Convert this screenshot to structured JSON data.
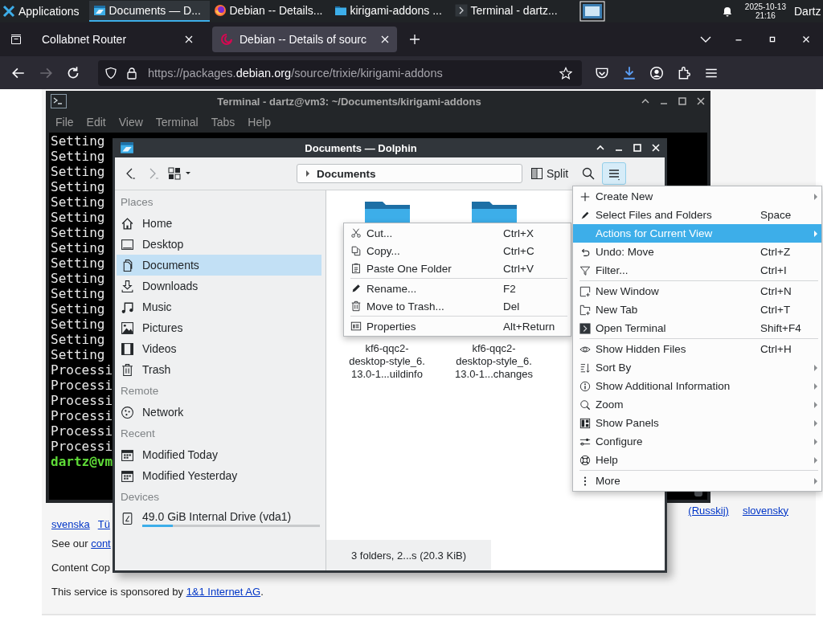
{
  "taskbar": {
    "launcher": "Applications",
    "tasks": [
      {
        "label": "Documents — D...",
        "kind": "dolphin",
        "selected": true
      },
      {
        "label": "Debian -- Details...",
        "kind": "firefox",
        "selected": false
      },
      {
        "label": "kirigami-addons ...",
        "kind": "folder",
        "selected": false
      },
      {
        "label": "Terminal - dartz...",
        "kind": "terminal",
        "selected": false
      }
    ],
    "date": "2025-10-13",
    "time": "21:16",
    "user": "Dartz"
  },
  "browser": {
    "tabs": [
      {
        "label": "Collabnet Router",
        "selected": false,
        "kind": "plain"
      },
      {
        "label": "Debian -- Details of sourc",
        "selected": true,
        "kind": "debian"
      }
    ],
    "url": {
      "start": "https://packages.",
      "domain": "debian.org",
      "end": "/source/trixie/kirigami-addons"
    },
    "page": {
      "languages_1": [
        "(Russkij)",
        "slovensky"
      ],
      "languages_2": [
        "svenska",
        "Tü"
      ],
      "see_our": {
        "text": "See our ",
        "link": "cont"
      },
      "content": "Content Cop",
      "sponsor": {
        "text": "This service is sponsored by ",
        "link": "1&1 Internet AG",
        "end": "."
      }
    }
  },
  "terminal": {
    "title": "Terminal - dartz@vm3: ~/Documents/kirigami-addons",
    "menu": [
      "File",
      "Edit",
      "View",
      "Terminal",
      "Tabs",
      "Help"
    ],
    "lines": [
      {
        "text": "Setting",
        "kind": "output"
      },
      {
        "text": "Setting",
        "kind": "output"
      },
      {
        "text": "Setting",
        "kind": "output"
      },
      {
        "text": "Setting",
        "kind": "output"
      },
      {
        "text": "Setting",
        "kind": "output"
      },
      {
        "text": "Setting",
        "kind": "output"
      },
      {
        "text": "Setting",
        "kind": "output"
      },
      {
        "text": "Setting",
        "kind": "output"
      },
      {
        "text": "Setting",
        "kind": "output"
      },
      {
        "text": "Setting",
        "kind": "output"
      },
      {
        "text": "Setting",
        "kind": "output"
      },
      {
        "text": "Setting",
        "kind": "output"
      },
      {
        "text": "Setting",
        "kind": "output"
      },
      {
        "text": "Setting",
        "kind": "output"
      },
      {
        "text": "Setting",
        "kind": "output"
      },
      {
        "text": "Processi",
        "kind": "output"
      },
      {
        "text": "Processi",
        "kind": "output"
      },
      {
        "text": "Processi",
        "kind": "output"
      },
      {
        "text": "Processi",
        "kind": "output"
      },
      {
        "text": "Processi",
        "kind": "output"
      },
      {
        "text": "Processi",
        "kind": "output"
      },
      {
        "text": "dartz@vm",
        "kind": "prompt"
      }
    ]
  },
  "dolphin": {
    "title": "Documents — Dolphin",
    "breadcrumb": "Documents",
    "split": "Split",
    "sections": [
      {
        "title": "Places",
        "items": [
          {
            "label": "Home",
            "kind": "home",
            "selected": false
          },
          {
            "label": "Desktop",
            "kind": "desktop",
            "selected": false
          },
          {
            "label": "Documents",
            "kind": "documents",
            "selected": true
          },
          {
            "label": "Downloads",
            "kind": "downloads",
            "selected": false
          },
          {
            "label": "Music",
            "kind": "music",
            "selected": false
          },
          {
            "label": "Pictures",
            "kind": "pictures",
            "selected": false
          },
          {
            "label": "Videos",
            "kind": "videos",
            "selected": false
          },
          {
            "label": "Trash",
            "kind": "trash",
            "selected": false
          }
        ]
      },
      {
        "title": "Remote",
        "items": [
          {
            "label": "Network",
            "kind": "network",
            "selected": false
          }
        ]
      },
      {
        "title": "Recent",
        "items": [
          {
            "label": "Modified Today",
            "kind": "calendar",
            "selected": false
          },
          {
            "label": "Modified Yesterday",
            "kind": "calendar",
            "selected": false
          }
        ]
      },
      {
        "title": "Devices",
        "items": [
          {
            "label": "49.0 GiB Internal Drive (vda1)",
            "kind": "drive",
            "selected": false,
            "level": 0.17
          }
        ]
      }
    ],
    "folders": [
      {
        "kind": "folder"
      },
      {
        "kind": "folder"
      }
    ],
    "files": [
      {
        "name": "kf6-qqc2-\ndesktop-style_6.\n13.0-1...uildinfo"
      },
      {
        "name": "kf6-qqc2-\ndesktop-style_6.\n13.0-1...changes"
      }
    ],
    "status": "3 folders, 2...s (20.3 KiB)"
  },
  "context_menu": {
    "groups": [
      [
        {
          "label": "Cut...",
          "shortcut": "Ctrl+X",
          "kind": "scissors",
          "selected": false
        },
        {
          "label": "Copy...",
          "shortcut": "Ctrl+C",
          "kind": "copy",
          "selected": false
        },
        {
          "label": "Paste One Folder",
          "shortcut": "Ctrl+V",
          "kind": "paste",
          "selected": false
        }
      ],
      [
        {
          "label": "Rename...",
          "shortcut": "F2",
          "kind": "pencil",
          "selected": false
        },
        {
          "label": "Move to Trash...",
          "shortcut": "Del",
          "kind": "trash",
          "selected": false
        }
      ],
      [
        {
          "label": "Properties",
          "shortcut": "Alt+Return",
          "kind": "properties",
          "selected": false
        }
      ]
    ]
  },
  "app_menu": {
    "groups": [
      [
        {
          "label": "Create New",
          "kind": "plus",
          "submenu": true,
          "selected": false
        },
        {
          "label": "Select Files and Folders",
          "shortcut": "Space",
          "kind": "marker",
          "submenu": false,
          "selected": false
        },
        {
          "label": "Actions for Current View",
          "kind": "plain",
          "submenu": true,
          "selected": true
        },
        {
          "label": "Undo: Move",
          "shortcut": "Ctrl+Z",
          "kind": "undo",
          "submenu": false,
          "selected": false
        },
        {
          "label": "Filter...",
          "shortcut": "Ctrl+I",
          "kind": "filter",
          "submenu": false,
          "selected": false
        }
      ],
      [
        {
          "label": "New Window",
          "shortcut": "Ctrl+N",
          "kind": "new-window",
          "submenu": false,
          "selected": false
        },
        {
          "label": "New Tab",
          "shortcut": "Ctrl+T",
          "kind": "new-tab",
          "submenu": false,
          "selected": false
        },
        {
          "label": "Open Terminal",
          "shortcut": "Shift+F4",
          "kind": "terminal",
          "submenu": false,
          "selected": false
        }
      ],
      [
        {
          "label": "Show Hidden Files",
          "shortcut": "Ctrl+H",
          "kind": "eye",
          "submenu": false,
          "selected": false
        },
        {
          "label": "Sort By",
          "kind": "sort",
          "submenu": true,
          "selected": false
        },
        {
          "label": "Show Additional Information",
          "kind": "info",
          "submenu": true,
          "selected": false
        },
        {
          "label": "Zoom",
          "kind": "zoom",
          "submenu": true,
          "selected": false
        },
        {
          "label": "Show Panels",
          "kind": "panels",
          "submenu": true,
          "selected": false
        },
        {
          "label": "Configure",
          "kind": "configure",
          "submenu": true,
          "selected": false
        },
        {
          "label": "Help",
          "kind": "help",
          "submenu": true,
          "selected": false
        }
      ],
      [
        {
          "label": "More",
          "kind": "more",
          "submenu": true,
          "selected": false
        }
      ]
    ]
  }
}
